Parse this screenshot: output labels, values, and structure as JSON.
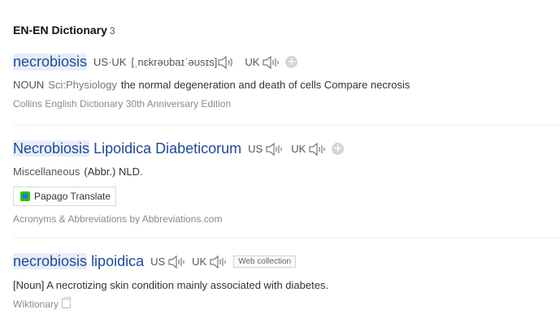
{
  "section": {
    "title": "EN-EN Dictionary",
    "count": "3"
  },
  "entries": [
    {
      "headword": "necrobiosis",
      "pron_us_uk_label": "US·UK",
      "ipa": "[ˌnɛkrəʊbaɪˈəʊsɪs]",
      "pron_uk_label": "UK",
      "pos": "NOUN",
      "field": "Sci:Physiology",
      "definition": "the normal degeneration and death of cells Compare necrosis",
      "source": "Collins English Dictionary 30th Anniversary Edition"
    },
    {
      "headword_part1": "Necrobiosis",
      "headword_part2": "Lipoidica Diabeticorum",
      "pron_us_label": "US",
      "pron_uk_label": "UK",
      "pos": "Miscellaneous",
      "definition": "(Abbr.) NLD.",
      "papago_label": "Papago Translate",
      "source": "Acronyms & Abbreviations by Abbreviations.com"
    },
    {
      "headword_part1": "necrobiosis",
      "headword_part2": "lipoidica",
      "pron_us_label": "US",
      "pron_uk_label": "UK",
      "tag": "Web collection",
      "definition": "[Noun] A necrotizing skin condition mainly associated with diabetes.",
      "source": "Wiktionary"
    }
  ],
  "icons": {
    "speaker": "speaker-icon",
    "add": "plus-circle-icon",
    "copy": "copy-icon",
    "papago": "papago-logo-icon"
  },
  "colors": {
    "headword": "#1d4aa0",
    "highlight": "#e8eef8",
    "divider": "#eeeeee"
  }
}
